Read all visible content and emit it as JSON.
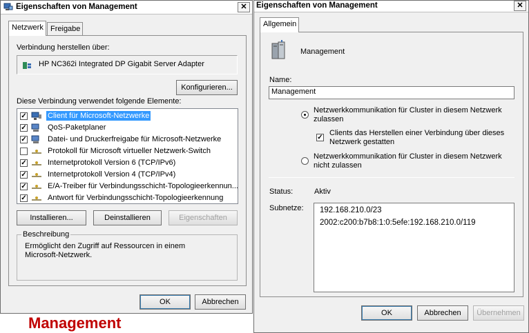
{
  "left_dialog": {
    "title": "Eigenschaften von Management",
    "close_glyph": "✕",
    "tabs": [
      "Netzwerk",
      "Freigabe"
    ],
    "connect_using_label": "Verbindung herstellen über:",
    "adapter_name": "HP NC362i Integrated DP Gigabit Server Adapter",
    "configure_button": "Konfigurieren...",
    "elements_label": "Diese Verbindung verwendet folgende Elemente:",
    "items": [
      {
        "label": "Client für Microsoft-Netzwerke",
        "checked": true,
        "icon": "network-client-icon"
      },
      {
        "label": "QoS-Paketplaner",
        "checked": true,
        "icon": "qos-icon"
      },
      {
        "label": "Datei- und Druckerfreigabe für Microsoft-Netzwerke",
        "checked": true,
        "icon": "file-printer-sharing-icon"
      },
      {
        "label": "Protokoll für Microsoft virtueller Netzwerk-Switch",
        "checked": false,
        "icon": "protocol-icon"
      },
      {
        "label": "Internetprotokoll Version 6 (TCP/IPv6)",
        "checked": true,
        "icon": "protocol-icon"
      },
      {
        "label": "Internetprotokoll Version 4 (TCP/IPv4)",
        "checked": true,
        "icon": "protocol-icon"
      },
      {
        "label": "E/A-Treiber für Verbindungsschicht-Topologieerkennun...",
        "checked": true,
        "icon": "protocol-icon"
      },
      {
        "label": "Antwort für Verbindungsschicht-Topologieerkennung",
        "checked": true,
        "icon": "protocol-icon"
      }
    ],
    "install_button": "Installieren...",
    "uninstall_button": "Deinstallieren",
    "properties_button": "Eigenschaften",
    "description_legend": "Beschreibung",
    "description_text_1": "Ermöglicht den Zugriff auf Ressourcen in einem",
    "description_text_2": "Microsoft-Netzwerk.",
    "ok_button": "OK",
    "cancel_button": "Abbrechen"
  },
  "right_dialog": {
    "title": "Eigenschaften von Management",
    "close_glyph": "✕",
    "tab": "Allgemein",
    "network_name_header": "Management",
    "name_label": "Name:",
    "name_value": "Management",
    "radio_allow_line1": "Netzwerkkommunikation für Cluster in diesem Netzwerk",
    "radio_allow_line2": "zulassen",
    "radio_allow_selected": true,
    "clients_checkbox_line1": "Clients das Herstellen einer Verbindung über dieses",
    "clients_checkbox_line2": "Netzwerk gestatten",
    "clients_checkbox_checked": true,
    "radio_deny_line1": "Netzwerkkommunikation für Cluster in diesem Netzwerk",
    "radio_deny_line2": "nicht zulassen",
    "status_label": "Status:",
    "status_value": "Aktiv",
    "subnets_label": "Subnetze:",
    "subnets": [
      "192.168.210.0/23",
      "2002:c200:b7b8:1:0:5efe:192.168.210.0/119"
    ],
    "ok_button": "OK",
    "cancel_button": "Abbrechen",
    "apply_button": "Übernehmen"
  },
  "caption": "Management",
  "colors": {
    "selection": "#3399ff",
    "caption": "#c00000",
    "dialog_bg": "#f0f0f0"
  }
}
